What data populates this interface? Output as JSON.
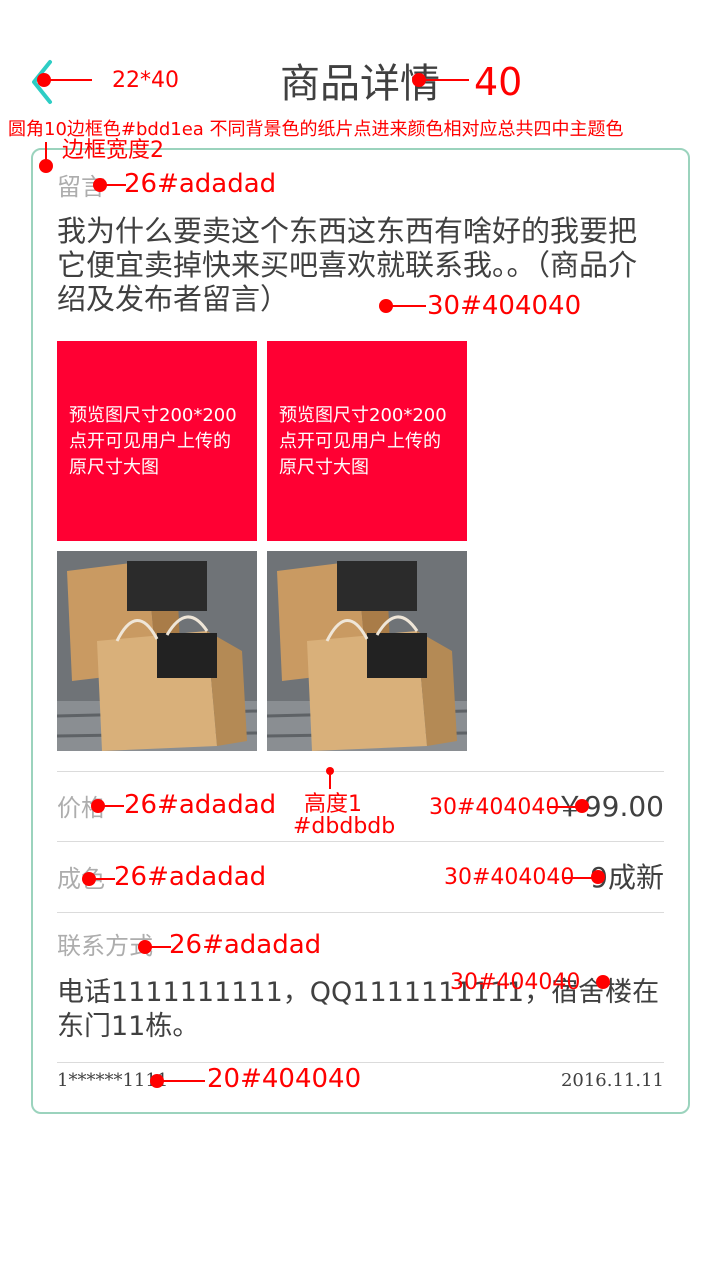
{
  "header": {
    "title": "商品详情",
    "back_icon_color": "#2dcdc4"
  },
  "message": {
    "label": "留言",
    "text": "我为什么要卖这个东西这东西有啥好的我要把它便宜卖掉快来买吧喜欢就联系我。。（商品介绍及发布者留言）"
  },
  "images": {
    "placeholder_text": "预览图尺寸200*200点开可见用户上传的原尺寸大图",
    "placeholder_color": "#ff0033"
  },
  "price": {
    "label": "价格",
    "value": "￥99.00"
  },
  "condition": {
    "label": "成色",
    "value": "9成新"
  },
  "contact": {
    "label": "联系方式",
    "text": "电话1111111111，QQ1111111111，宿舍楼在东门11栋。"
  },
  "footer": {
    "user": "1******1111",
    "date": "2016.11.11"
  },
  "annotations": {
    "back_size": "22*40",
    "title_size": "40",
    "card_note": "圆角10边框色#bdd1ea 不同背景色的纸片点进来颜色相对应总共四中主题色",
    "border_width": "边框宽度2",
    "msg_label": "26#adadad",
    "msg_text": "30#404040",
    "price_label": "26#adadad",
    "divider_height": "高度1",
    "divider_color": "#dbdbdb",
    "price_value": "30#404040",
    "condition_label": "26#adadad",
    "condition_value": "30#404040",
    "contact_label": "26#adadad",
    "contact_text": "30#404040",
    "footer_user": "20#404040"
  },
  "colors": {
    "annotation": "#ff0000",
    "card_border": "#9bd3bd",
    "muted_text": "#adadad",
    "body_text": "#404040",
    "divider": "#dbdbdb"
  }
}
